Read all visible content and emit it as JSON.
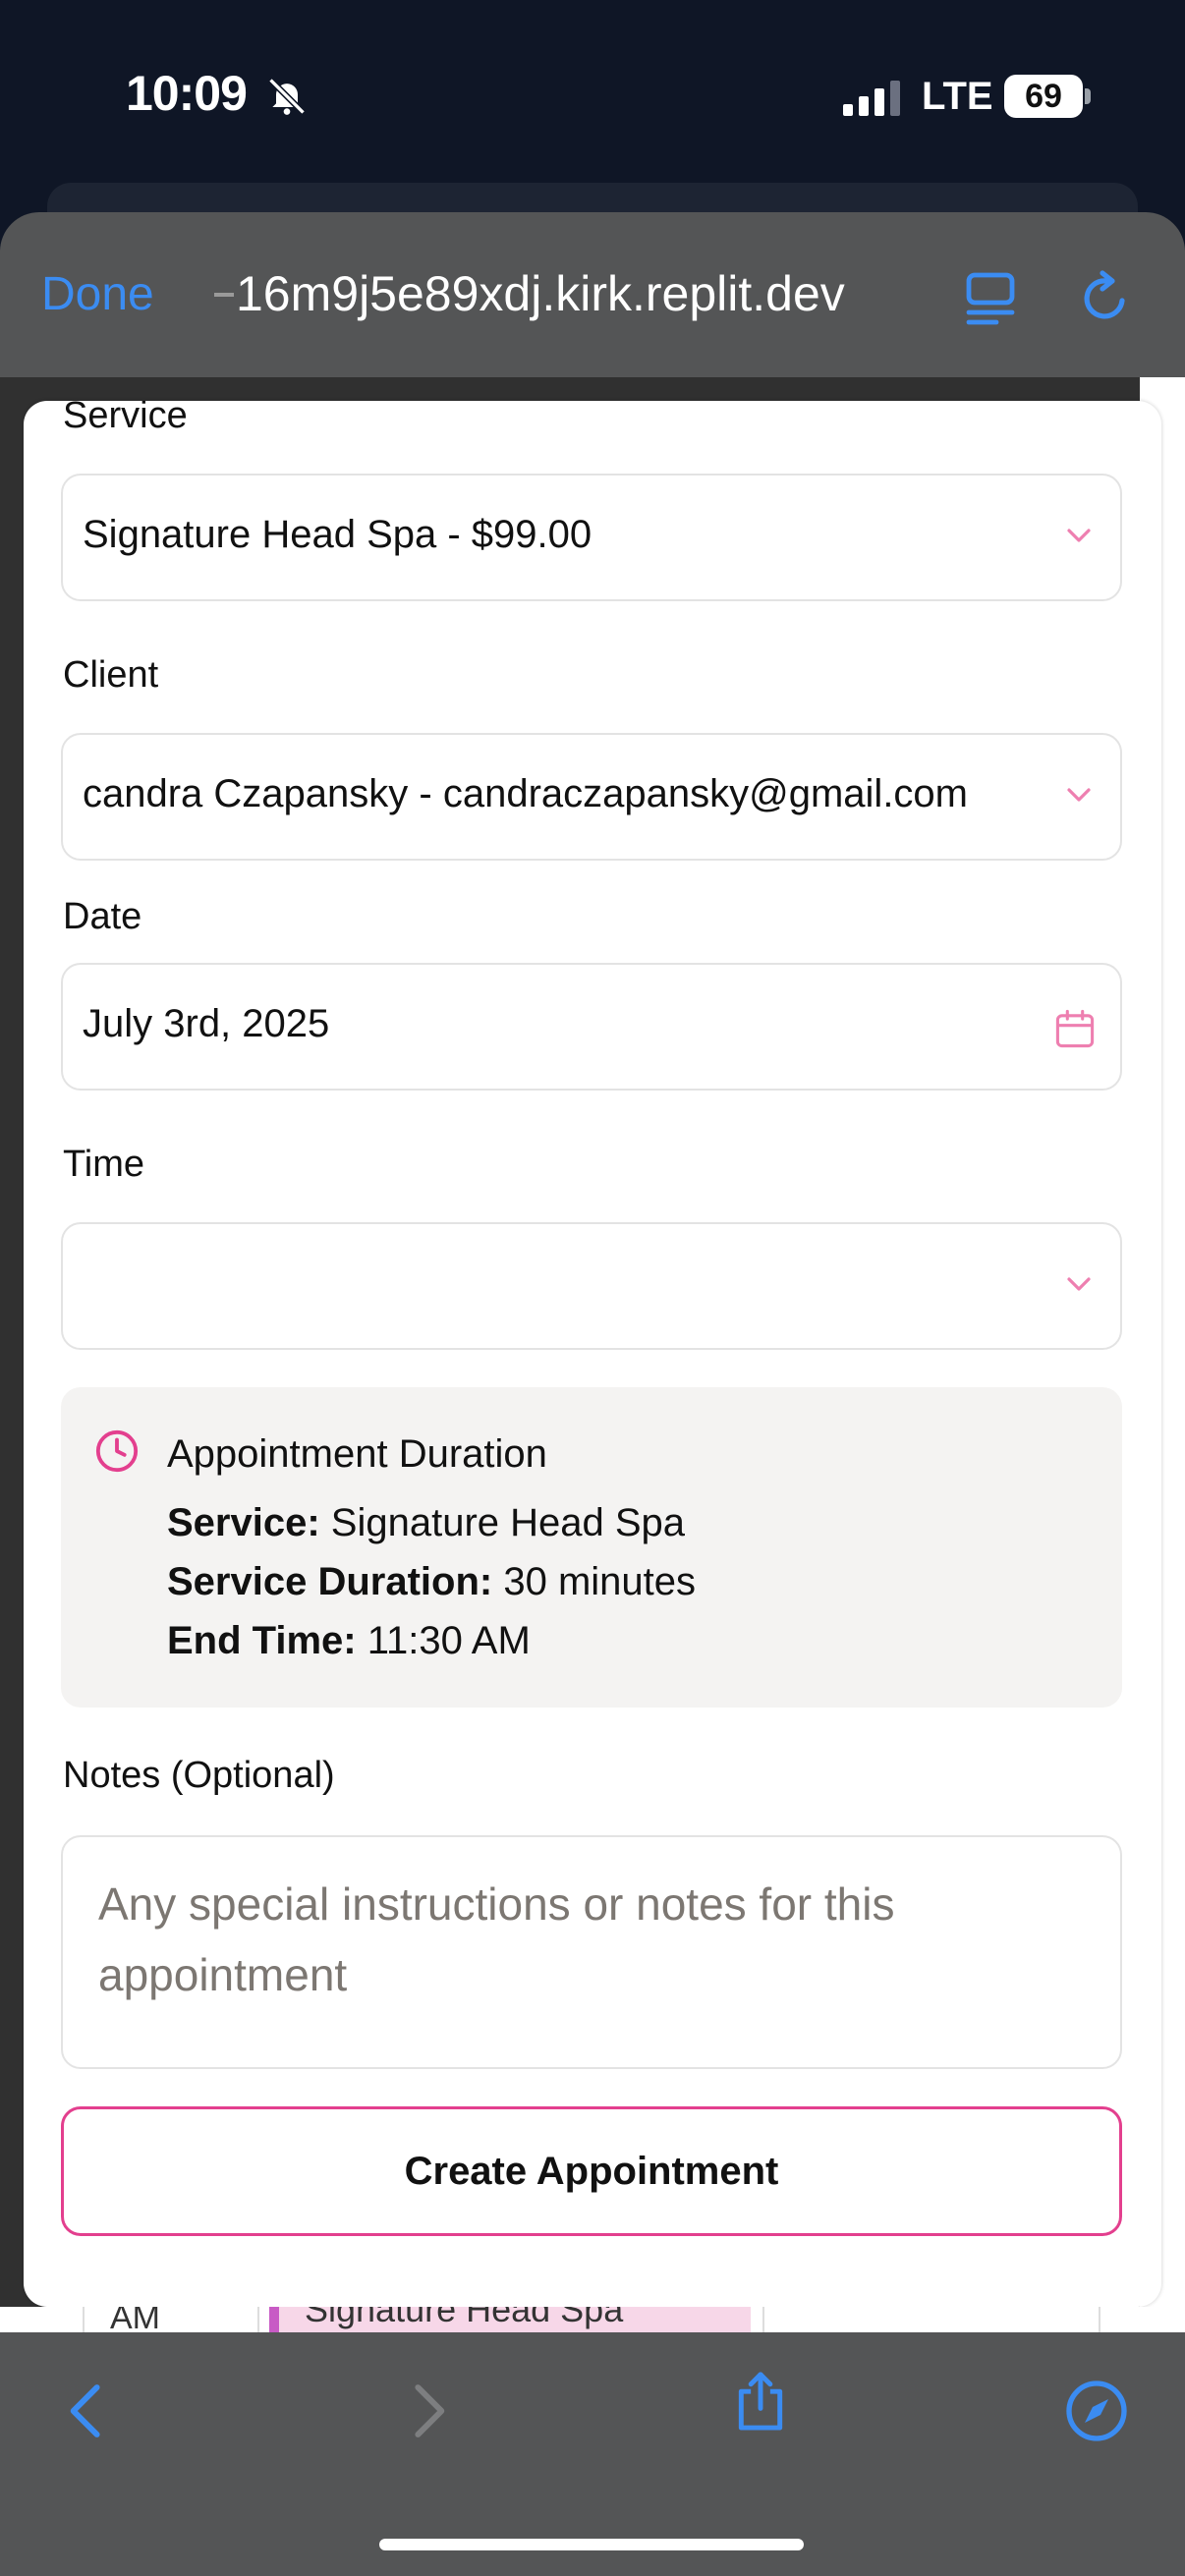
{
  "status_bar": {
    "time": "10:09",
    "network": "LTE",
    "battery": "69"
  },
  "browser": {
    "done_label": "Done",
    "url": "16m9j5e89xdj.kirk.replit.dev"
  },
  "form": {
    "service": {
      "label": "Service",
      "value": "Signature Head Spa - $99.00"
    },
    "client": {
      "label": "Client",
      "value": "candra Czapansky - candraczapansky@gmail.com"
    },
    "date": {
      "label": "Date",
      "value": "July 3rd, 2025"
    },
    "time": {
      "label": "Time",
      "value": ""
    },
    "duration": {
      "title": "Appointment Duration",
      "service_label": "Service:",
      "service_value": "Signature Head Spa",
      "duration_label": "Service Duration:",
      "duration_value": "30 minutes",
      "end_label": "End Time:",
      "end_value": "11:30 AM"
    },
    "notes": {
      "label": "Notes (Optional)",
      "placeholder": "Any special instructions or notes for this appointment"
    },
    "submit_label": "Create Appointment"
  },
  "background_calendar": {
    "time_label": "AM",
    "event_label": "Signature Head Spa"
  },
  "colors": {
    "accent_pink": "#e33f8e",
    "link_blue": "#3b8cf2",
    "chrome_gray": "#545556"
  },
  "icons": [
    "bell-slash-icon",
    "signal-icon",
    "reader-icon",
    "reload-icon",
    "chevron-down-icon",
    "calendar-icon",
    "clock-icon",
    "back-icon",
    "forward-icon",
    "share-icon",
    "compass-icon"
  ]
}
